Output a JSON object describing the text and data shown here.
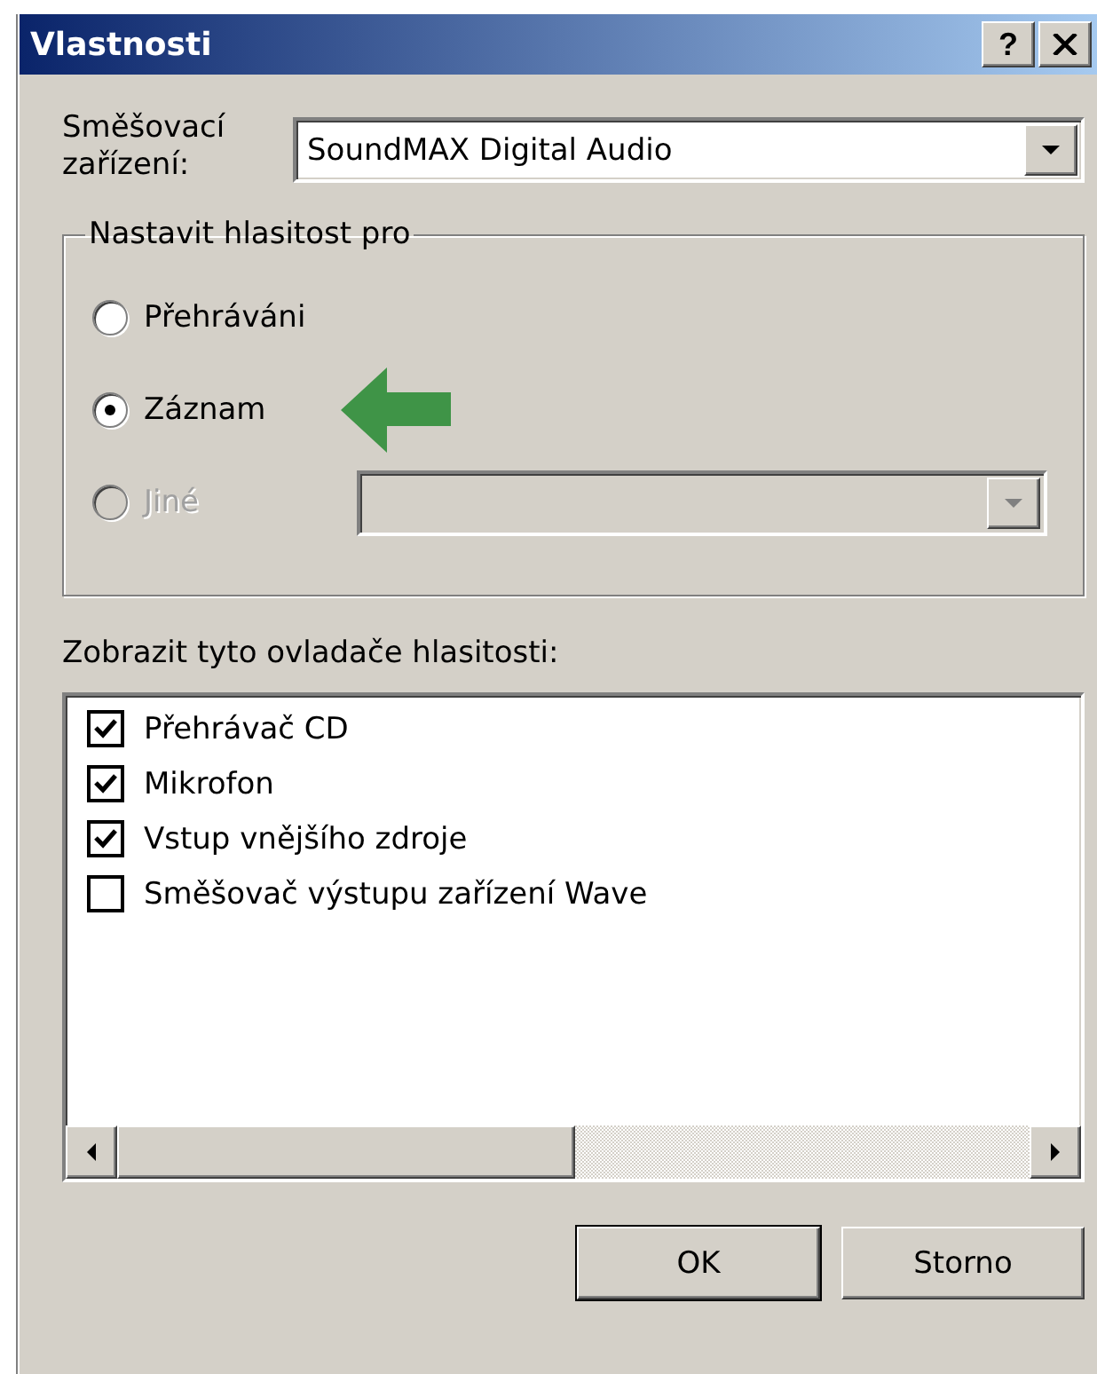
{
  "window": {
    "title": "Vlastnosti",
    "help_button": "?"
  },
  "mixer_device": {
    "label": "Směšovací zařízení:",
    "value": "SoundMAX Digital Audio"
  },
  "volume_for": {
    "title": "Nastavit hlasitost pro",
    "options": [
      {
        "kind": "radio",
        "label": "Přehráváni",
        "selected": false,
        "disabled": false
      },
      {
        "kind": "radio",
        "label": "Záznam",
        "selected": true,
        "disabled": false
      },
      {
        "kind": "radio-combo",
        "label": "Jiné",
        "selected": false,
        "disabled": true
      }
    ]
  },
  "controls": {
    "label": "Zobrazit tyto ovladače hlasitosti:",
    "items": [
      {
        "label": "Přehrávač CD",
        "checked": true
      },
      {
        "label": "Mikrofon",
        "checked": true
      },
      {
        "label": "Vstup vnějšího zdroje",
        "checked": true
      },
      {
        "label": "Směšovač výstupu zařízení Wave",
        "checked": false
      }
    ]
  },
  "buttons": [
    {
      "label": "OK",
      "default": true
    },
    {
      "label": "Storno",
      "default": false
    }
  ]
}
